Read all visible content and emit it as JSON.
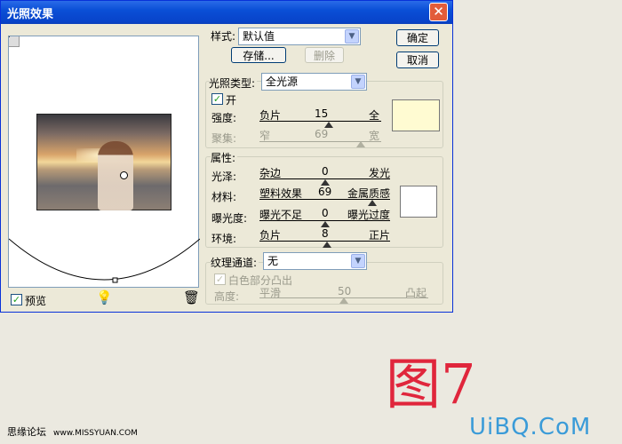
{
  "dialog": {
    "title": "光照效果",
    "close_glyph": "✕"
  },
  "preview_panel": {
    "preview_label": "预览",
    "preview_checked": true,
    "checkbox_glyph": "✓"
  },
  "style": {
    "label": "样式:",
    "value": "默认值",
    "save_button": "存储...",
    "delete_button": "删除"
  },
  "buttons": {
    "ok": "确定",
    "cancel": "取消"
  },
  "light_type": {
    "label": "光照类型:",
    "value": "全光源",
    "on_label": "开",
    "on_checked": true,
    "swatch_color": "#fffbd2",
    "intensity": {
      "label": "强度:",
      "min_label": "负片",
      "value": "15",
      "max_label": "全"
    },
    "focus": {
      "label": "聚集:",
      "min_label": "窄",
      "value": "69",
      "max_label": "宽"
    }
  },
  "properties": {
    "group_label": "属性:",
    "swatch_color": "#ffffff",
    "gloss": {
      "label": "光泽:",
      "min_label": "杂边",
      "value": "0",
      "max_label": "发光"
    },
    "material": {
      "label": "材料:",
      "min_label": "塑料效果",
      "value": "69",
      "max_label": "金属质感"
    },
    "exposure": {
      "label": "曝光度:",
      "min_label": "曝光不足",
      "value": "0",
      "max_label": "曝光过度"
    },
    "ambience": {
      "label": "环境:",
      "min_label": "负片",
      "value": "8",
      "max_label": "正片"
    }
  },
  "texture": {
    "label": "纹理通道:",
    "value": "无",
    "white_high_label": "白色部分凸出",
    "height": {
      "label": "高度:",
      "min_label": "平滑",
      "value": "50",
      "max_label": "凸起"
    }
  },
  "icons": {
    "light_bulb": "bulb-icon",
    "trash": "trash-icon"
  },
  "caption": "图7",
  "watermark_left": {
    "text": "思缘论坛",
    "url": "www.MISSYUAN.COM"
  },
  "watermark_right": "UiBQ.CoM",
  "dropdown_arrow": "▼",
  "bulb_glyph": "💡",
  "trash_glyph": "🗑"
}
